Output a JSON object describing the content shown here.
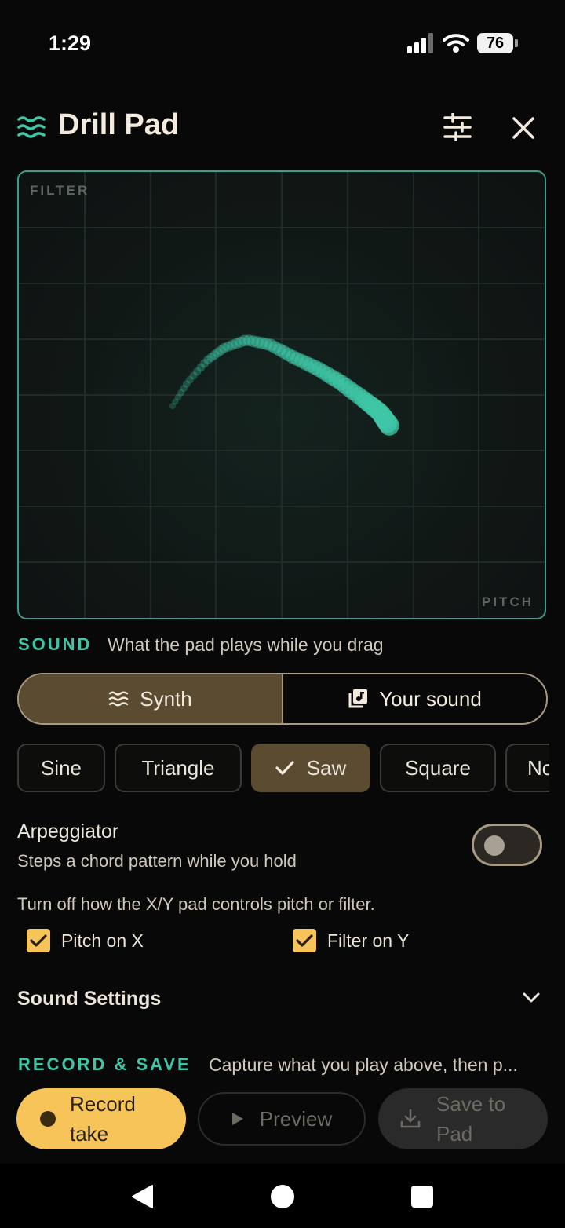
{
  "status": {
    "time": "1:29",
    "battery": "76"
  },
  "header": {
    "title": "Drill Pad",
    "icon": "waves-icon",
    "settings_icon": "tune-icon",
    "close_icon": "close-icon"
  },
  "pad": {
    "label_top": "FILTER",
    "label_bottom": "PITCH",
    "accent_color": "#3fc6a6",
    "grid_divisions": 8
  },
  "sound": {
    "kicker": "SOUND",
    "description": "What the pad plays while you drag",
    "source_tabs": [
      {
        "label": "Synth",
        "icon": "waves-icon",
        "selected": true
      },
      {
        "label": "Your sound",
        "icon": "music-library-icon",
        "selected": false
      }
    ],
    "waveforms": [
      {
        "label": "Sine",
        "selected": false
      },
      {
        "label": "Triangle",
        "selected": false
      },
      {
        "label": "Saw",
        "selected": true
      },
      {
        "label": "Square",
        "selected": false
      },
      {
        "label": "Noise",
        "selected": false
      }
    ],
    "arpeggiator": {
      "title": "Arpeggiator",
      "description": "Steps a chord pattern while you hold",
      "on": false
    },
    "xy_note": "Turn off how the X/Y pad controls pitch or filter.",
    "checks": [
      {
        "label": "Pitch on X",
        "checked": true
      },
      {
        "label": "Filter on Y",
        "checked": true
      }
    ],
    "settings_label": "Sound Settings"
  },
  "record": {
    "kicker": "RECORD & SAVE",
    "description": "Capture what you play above, then p...",
    "record_label": "Record take",
    "preview_label": "Preview",
    "save_label": "Save to Pad"
  },
  "colors": {
    "accent": "#3fc6a6",
    "gold": "#f7c45a",
    "selected_bg": "#5b4b30"
  }
}
